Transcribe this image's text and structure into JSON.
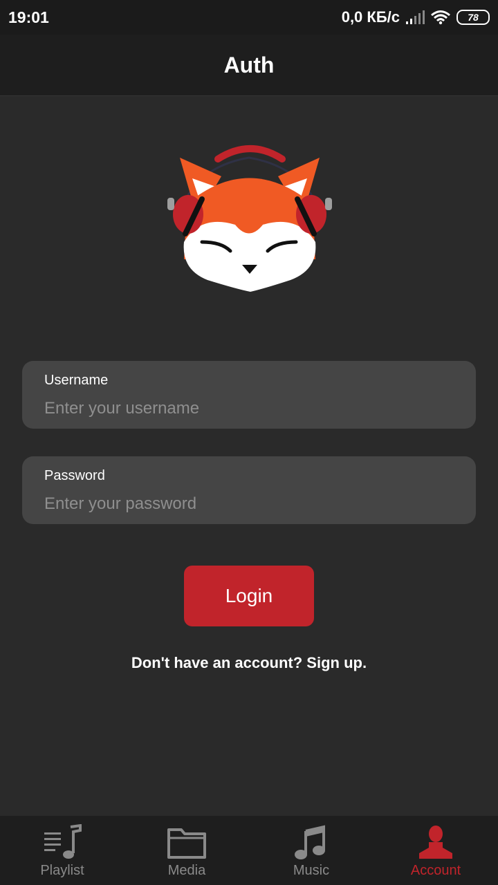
{
  "status_bar": {
    "time": "19:01",
    "net_speed": "0,0 КБ/с",
    "battery": "78"
  },
  "app_bar": {
    "title": "Auth"
  },
  "form": {
    "username": {
      "label": "Username",
      "placeholder": "Enter your username",
      "value": ""
    },
    "password": {
      "label": "Password",
      "placeholder": "Enter your password",
      "value": ""
    },
    "login_label": "Login",
    "signup_text": "Don't have an account? Sign up."
  },
  "bottom_nav": {
    "active": "Account",
    "items": [
      {
        "label": "Playlist",
        "icon": "playlist-icon"
      },
      {
        "label": "Media",
        "icon": "folder-icon"
      },
      {
        "label": "Music",
        "icon": "music-note-icon"
      },
      {
        "label": "Account",
        "icon": "person-icon"
      }
    ]
  },
  "colors": {
    "accent": "#c1242b",
    "background": "#2a2a2a",
    "field": "#454545",
    "inactive_nav": "#8a8a8a"
  }
}
